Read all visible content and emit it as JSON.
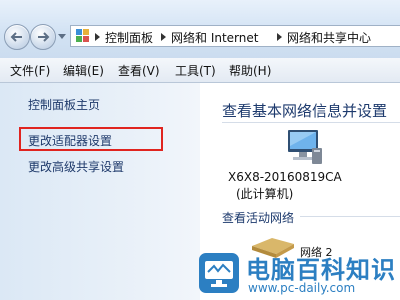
{
  "breadcrumb": [
    "控制面板",
    "网络和 Internet",
    "网络和共享中心"
  ],
  "menu": [
    "文件(F)",
    "编辑(E)",
    "查看(V)",
    "工具(T)",
    "帮助(H)"
  ],
  "sidebar": {
    "home": "控制面板主页",
    "adapter": "更改适配器设置",
    "advanced": "更改高级共享设置"
  },
  "main": {
    "title": "查看基本网络信息并设置",
    "computer_name": "X6X8-20160819CA",
    "computer_sub": "(此计算机)",
    "active_networks": "查看活动网络",
    "network_name": "网络 2"
  },
  "watermark": {
    "title": "电脑百科知识",
    "url": "www.pc-daily.com"
  },
  "colors": {
    "highlight": "#e0241f",
    "watermark": "#2c7fc2",
    "link": "#1f3a6b"
  },
  "icons": [
    "back-arrow-icon",
    "forward-arrow-icon",
    "control-panel-icon",
    "computer-icon",
    "network-icon"
  ]
}
